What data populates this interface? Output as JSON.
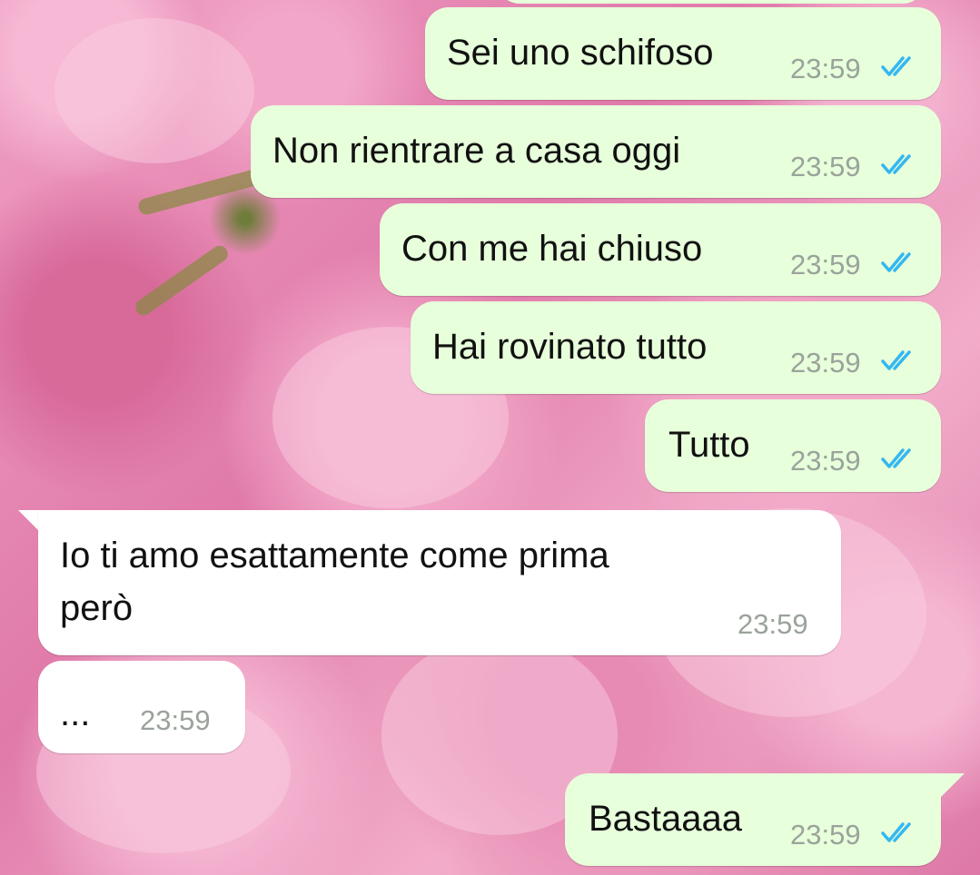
{
  "messages": [
    {
      "text": "Sei uno schifoso",
      "time": "23:59",
      "status_icon": "double-check-read-icon"
    },
    {
      "text": "Non rientrare a casa oggi",
      "time": "23:59",
      "status_icon": "double-check-read-icon"
    },
    {
      "text": "Con me hai chiuso",
      "time": "23:59",
      "status_icon": "double-check-read-icon"
    },
    {
      "text": "Hai rovinato tutto",
      "time": "23:59",
      "status_icon": "double-check-read-icon"
    },
    {
      "text": "Tutto",
      "time": "23:59",
      "status_icon": "double-check-read-icon"
    },
    {
      "line1": "Io ti amo esattamente come prima",
      "line2": "però",
      "time": "23:59"
    },
    {
      "text": "...",
      "time": "23:59"
    },
    {
      "text": "Bastaaaa",
      "time": "23:59",
      "status_icon": "double-check-read-icon"
    }
  ],
  "colors": {
    "outgoing_bubble": "#e7ffdb",
    "incoming_bubble": "#ffffff",
    "timestamp": "#9aa39b",
    "read_ticks": "#34b7f1",
    "background": "#e98ab6"
  },
  "background_image": "pink-roses"
}
